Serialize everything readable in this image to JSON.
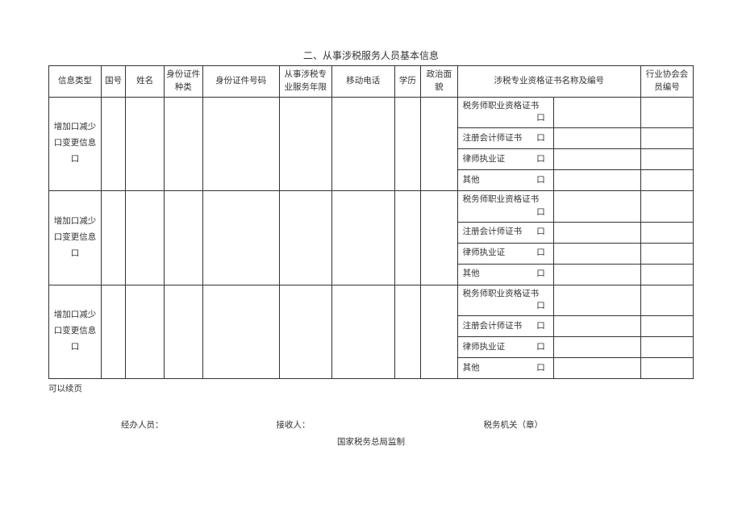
{
  "title": "二、从事涉税服务人员基本信息",
  "headers": {
    "info_type": "信息类型",
    "nationality": "国号",
    "name": "姓名",
    "id_kind": "身份证件种类",
    "id_no": "身份证件号码",
    "service_years": "从事涉税专业服务年限",
    "mobile": "移动电话",
    "education": "学历",
    "politics": "政治面貌",
    "cert_name_no": "涉税专业资格证书名称及编号",
    "assoc_member": "行业协会会员编号"
  },
  "row_label": "增加口减少口变更信息口",
  "certs": [
    {
      "label": "税务师职业资格证书",
      "box": "口"
    },
    {
      "label": "注册会计师证书",
      "box": "口"
    },
    {
      "label": "律师执业证",
      "box": "口"
    },
    {
      "label": "其他",
      "box": "口"
    }
  ],
  "note": "可以续页",
  "footer": {
    "handler": "经办人员：",
    "receiver": "接收人：",
    "authority": "税务机关（章）",
    "issuer": "国家税务总局监制"
  }
}
